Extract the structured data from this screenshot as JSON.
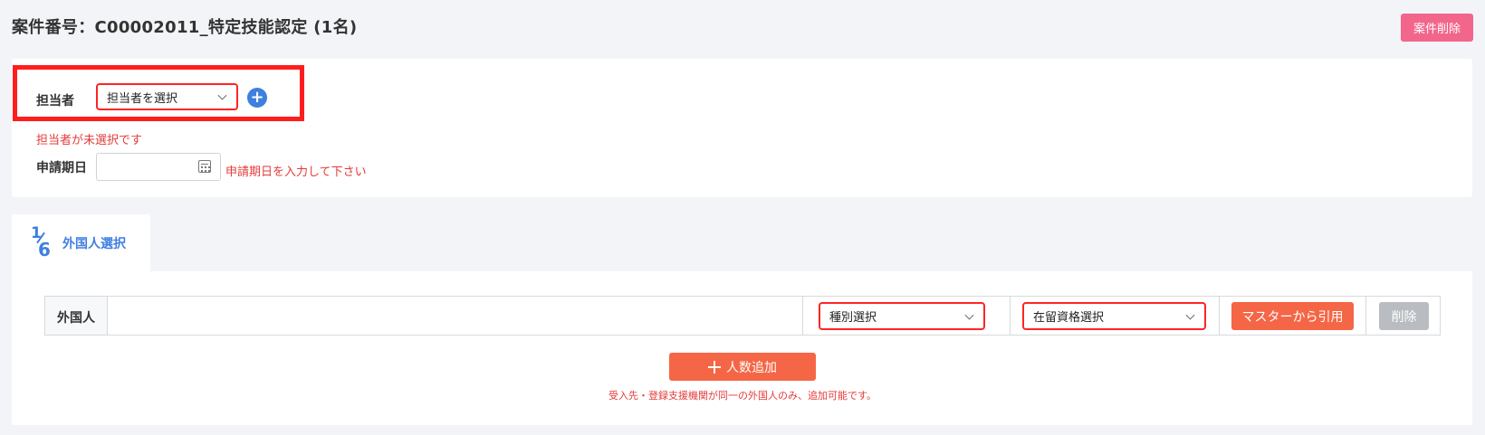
{
  "header": {
    "title": "案件番号：C00002011_特定技能認定 (1名)",
    "delete_case_label": "案件削除"
  },
  "assignee": {
    "label": "担当者",
    "select_value": "担当者を選択",
    "error": "担当者が未選択です"
  },
  "application_date": {
    "label": "申請期日",
    "value": "",
    "error": "申請期日を入力して下さい"
  },
  "step": {
    "current": "1",
    "total": "6",
    "label": "外国人選択"
  },
  "foreigner_row": {
    "label": "外国人",
    "type_select": "種別選択",
    "status_select": "在留資格選択",
    "quote_master_label": "マスターから引用",
    "delete_label": "削除"
  },
  "add_people": {
    "label": "人数追加",
    "note": "受入先・登録支援機関が同一の外国人のみ、追加可能です。"
  },
  "colors": {
    "accent_blue": "#3e7fe0",
    "error_red": "#e53a3a",
    "highlight_red": "#ff1d1d",
    "button_orange": "#f56646",
    "button_pink": "#f2668b",
    "disabled_gray": "#b9bcc1"
  },
  "icons": {
    "add_assignee": "plus-circle-icon",
    "calendar": "calendar-icon",
    "dropdown": "chevron-down-icon",
    "add": "plus-icon"
  }
}
